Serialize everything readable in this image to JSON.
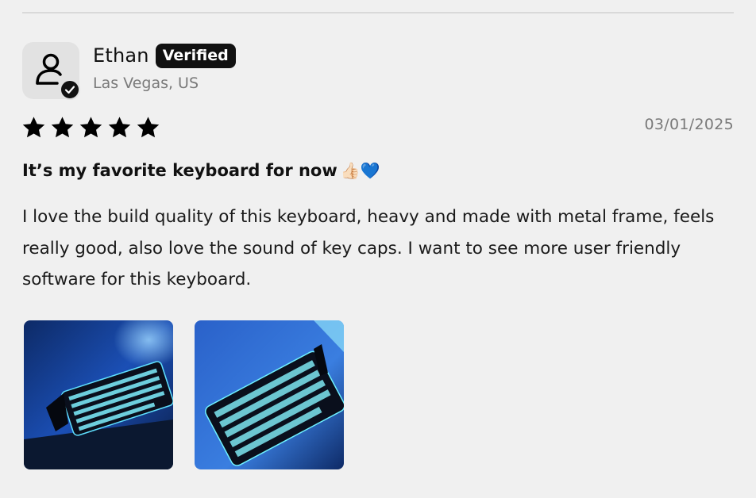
{
  "review": {
    "author": "Ethan",
    "badge": "Verified",
    "location": "Las Vegas, US",
    "rating": 5,
    "date": "03/01/2025",
    "title": "It’s my favorite keyboard for now",
    "title_emoji": "👍🏻💙",
    "body": "I love the build quality of this keyboard, heavy and made with metal frame, feels really good, also love the sound of key caps. I want to see more user friendly software for this keyboard.",
    "photos": [
      "keyboard-photo-1",
      "keyboard-photo-2"
    ]
  },
  "icons": {
    "avatar": "user-icon",
    "verified": "check-circle-icon",
    "star": "star-icon"
  },
  "colors": {
    "background": "#f0f0f0",
    "badge_bg": "#111111",
    "muted_text": "#7a7a7a",
    "star": "#000000"
  }
}
